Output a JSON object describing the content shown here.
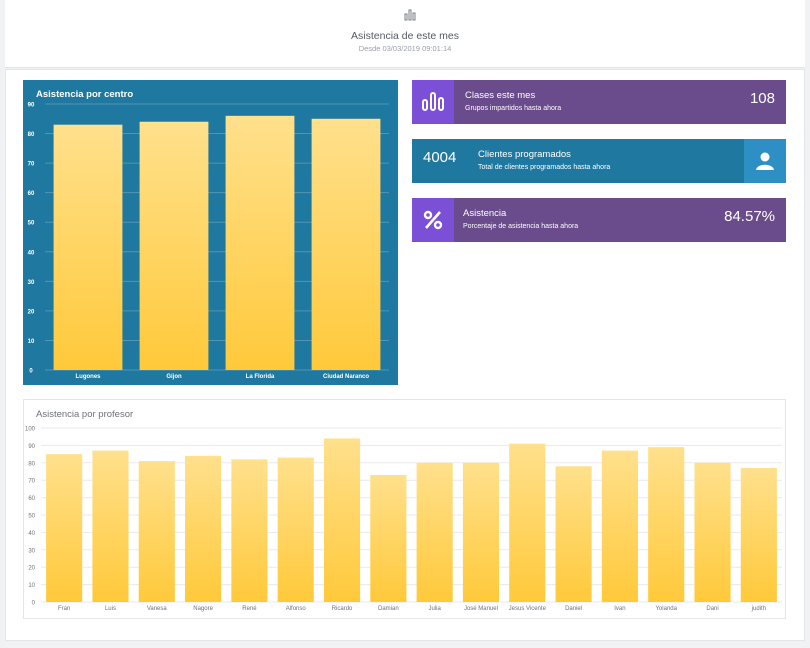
{
  "header": {
    "icon": "bar-chart-icon",
    "title": "Asistencia de este mes",
    "subtitle": "Desde 03/03/2019 09:01:14"
  },
  "kpis": [
    {
      "label": "Clases este mes",
      "sub": "Grupos impartidos hasta ahora",
      "value": "108",
      "icon": "bar-chart-icon",
      "color": "#6a4b8c",
      "icon_bg": "#7b4fd6"
    },
    {
      "label": "Clientes programados",
      "sub": "Total de clientes programados hasta ahora",
      "value": "4004",
      "icon": "user-icon",
      "color": "#1f789f",
      "icon_bg": "#2e8fc4"
    },
    {
      "label": "Asistencia",
      "sub": "Porcentaje de asistencia hasta ahora",
      "value": "84.57%",
      "icon": "percent-icon",
      "color": "#6a4b8c",
      "icon_bg": "#7b4fd6"
    }
  ],
  "chart_data": [
    {
      "type": "bar",
      "title": "Asistencia por centro",
      "categories": [
        "Lugones",
        "Gijon",
        "La Florida",
        "Ciudad Naranco"
      ],
      "values": [
        83,
        84,
        86,
        85
      ],
      "ylim": [
        0,
        90
      ],
      "yticks": [
        0,
        10,
        20,
        30,
        40,
        50,
        60,
        70,
        80,
        90
      ],
      "grid": true,
      "legend": "none",
      "background": "#1f789f",
      "bar_color_top": "#ffe08c",
      "bar_color_bottom": "#ffc93a"
    },
    {
      "type": "bar",
      "title": "Asistencia por profesor",
      "categories": [
        "Fran",
        "Luis",
        "Vanesa",
        "Nagore",
        "René",
        "Alfonso",
        "Ricardo",
        "Damian",
        "Julia",
        "José Manuel",
        "Jesus Vicente",
        "Daniel",
        "Ivan",
        "Yolanda",
        "Dani",
        "judith"
      ],
      "values": [
        85,
        87,
        81,
        84,
        82,
        83,
        94,
        73,
        80,
        80,
        91,
        78,
        87,
        89,
        80,
        77
      ],
      "ylim": [
        0,
        100
      ],
      "yticks": [
        0,
        10,
        20,
        30,
        40,
        50,
        60,
        70,
        80,
        90,
        100
      ],
      "grid": true,
      "legend": "none",
      "bar_color_top": "#ffe08c",
      "bar_color_bottom": "#ffc93a"
    }
  ]
}
